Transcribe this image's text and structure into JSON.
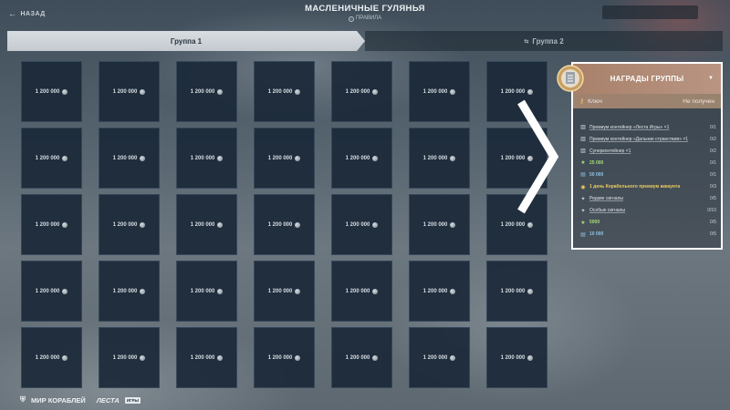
{
  "header": {
    "back_label": "НАЗАД",
    "title": "МАСЛЕНИЧНЫЕ ГУЛЯНЬЯ",
    "rules_label": "ПРАВИЛА"
  },
  "tabs": [
    {
      "label": "Группа 1",
      "active": true
    },
    {
      "label": "Группа 2",
      "active": false,
      "locked": true
    }
  ],
  "grid": {
    "cell_value": "1 200 000",
    "columns": 7,
    "rows": 5
  },
  "rewards": {
    "title": "НАГРАДЫ ГРУППЫ",
    "key_label": "Ключ",
    "key_status": "Не получен",
    "items": [
      {
        "icon": "container-icon",
        "label": "Премиум контейнер «Леста Игры» ×1",
        "progress": "0/1",
        "style": "u"
      },
      {
        "icon": "container-icon",
        "label": "Премиум контейнер «Дальние странствия» ×1",
        "progress": "0/2",
        "style": "u"
      },
      {
        "icon": "container-icon",
        "label": "Суперконтейнер ×1",
        "progress": "0/2",
        "style": "u"
      },
      {
        "icon": "star-icon",
        "label": "25 000",
        "progress": "0/1",
        "style": "green"
      },
      {
        "icon": "credits-icon",
        "label": "50 000",
        "progress": "0/1",
        "style": "blue"
      },
      {
        "icon": "premium-icon",
        "label": "1 день Корабельного премиум аккаунта",
        "progress": "0/3",
        "style": "gold"
      },
      {
        "icon": "signal-icon",
        "label": "Редкие сигналы",
        "progress": "0/5",
        "style": "u"
      },
      {
        "icon": "signal-icon",
        "label": "Особые сигналы",
        "progress": "0/10",
        "style": "u"
      },
      {
        "icon": "star-icon",
        "label": "5000",
        "progress": "0/5",
        "style": "green"
      },
      {
        "icon": "credits-icon",
        "label": "10 000",
        "progress": "0/5",
        "style": "blue"
      }
    ]
  },
  "footer": {
    "logo1": "МИР КОРАБЛЕЙ",
    "logo2": "ЛЕСТА",
    "logo2_badge": "ИГРЫ"
  },
  "colors": {
    "accent_panel": "#a9816b",
    "cell_bg": "#1a2838",
    "tab_active": "#d0d5da"
  }
}
